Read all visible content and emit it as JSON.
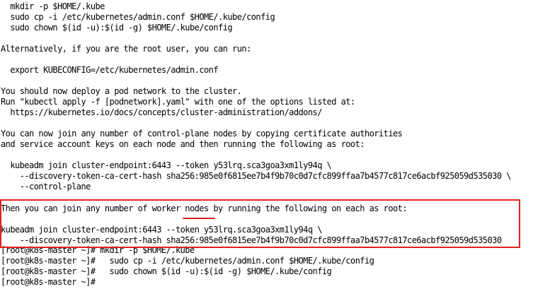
{
  "terminal": {
    "lines": [
      "  mkdir -p $HOME/.kube",
      "  sudo cp -i /etc/kubernetes/admin.conf $HOME/.kube/config",
      "  sudo chown $(id -u):$(id -g) $HOME/.kube/config",
      "",
      "Alternatively, if you are the root user, you can run:",
      "",
      "  export KUBECONFIG=/etc/kubernetes/admin.conf",
      "",
      "You should now deploy a pod network to the cluster.",
      "Run \"kubectl apply -f [podnetwork].yaml\" with one of the options listed at:",
      "  https://kubernetes.io/docs/concepts/cluster-administration/addons/",
      "",
      "You can now join any number of control-plane nodes by copying certificate authorities",
      "and service account keys on each node and then running the following as root:",
      "",
      "  kubeadm join cluster-endpoint:6443 --token y53lrq.sca3goa3xm1ly94q \\",
      "    --discovery-token-ca-cert-hash sha256:985e0f6815ee7b4f9b70c0d7cfc899ffaa7b4577c817ce6acbf925059d535030 \\",
      "    --control-plane",
      "",
      "Then you can join any number of worker nodes by running the following on each as root:",
      "",
      "kubeadm join cluster-endpoint:6443 --token y53lrq.sca3goa3xm1ly94q \\",
      "    --discovery-token-ca-cert-hash sha256:985e0f6815ee7b4f9b70c0d7cfc899ffaa7b4577c817ce6acbf925059d535030",
      "[root@k8s-master ~]# mkdir -p $HOME/.kube",
      "[root@k8s-master ~]#   sudo cp -i /etc/kubernetes/admin.conf $HOME/.kube/config",
      "[root@k8s-master ~]#   sudo chown $(id -u):$(id -g) $HOME/.kube/config",
      "[root@k8s-master ~]# "
    ],
    "annotation": {
      "box_color": "#e02020",
      "underline_color": "#e02020"
    },
    "colors": {
      "background": "#ffffff",
      "text": "#000000"
    }
  }
}
